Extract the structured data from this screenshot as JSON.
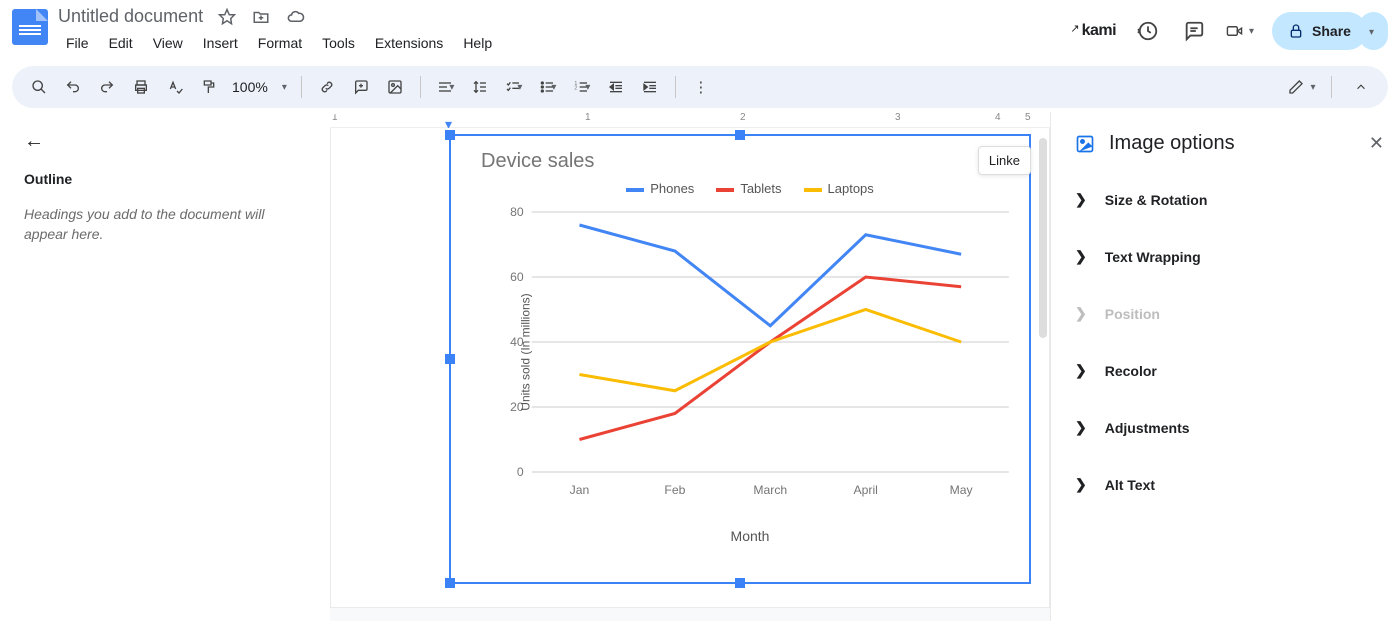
{
  "header": {
    "doc_title": "Untitled document",
    "kami": "kami"
  },
  "menus": [
    "File",
    "Edit",
    "View",
    "Insert",
    "Format",
    "Tools",
    "Extensions",
    "Help"
  ],
  "toolbar": {
    "zoom": "100%"
  },
  "share": {
    "label": "Share"
  },
  "outline": {
    "title": "Outline",
    "empty_text": "Headings you add to the document will appear here."
  },
  "ruler": {
    "indent_mark": "▾",
    "marks": [
      "1",
      "1",
      "2",
      "3",
      "4",
      "5"
    ]
  },
  "linked_chip": "Linke",
  "sidebar": {
    "title": "Image options",
    "items": [
      {
        "label": "Size & Rotation",
        "enabled": true
      },
      {
        "label": "Text Wrapping",
        "enabled": true
      },
      {
        "label": "Position",
        "enabled": false
      },
      {
        "label": "Recolor",
        "enabled": true
      },
      {
        "label": "Adjustments",
        "enabled": true
      },
      {
        "label": "Alt Text",
        "enabled": true
      }
    ]
  },
  "chart_data": {
    "type": "line",
    "title": "Device sales",
    "xlabel": "Month",
    "ylabel": "Units sold (In millions)",
    "categories": [
      "Jan",
      "Feb",
      "March",
      "April",
      "May"
    ],
    "yticks": [
      0,
      20,
      40,
      60,
      80
    ],
    "ylim": [
      0,
      80
    ],
    "series": [
      {
        "name": "Phones",
        "color": "#4285f4",
        "values": [
          76,
          68,
          45,
          73,
          67
        ]
      },
      {
        "name": "Tablets",
        "color": "#ea4335",
        "values": [
          10,
          18,
          40,
          60,
          57
        ]
      },
      {
        "name": "Laptops",
        "color": "#fbbc04",
        "values": [
          30,
          25,
          40,
          50,
          40
        ]
      }
    ]
  }
}
